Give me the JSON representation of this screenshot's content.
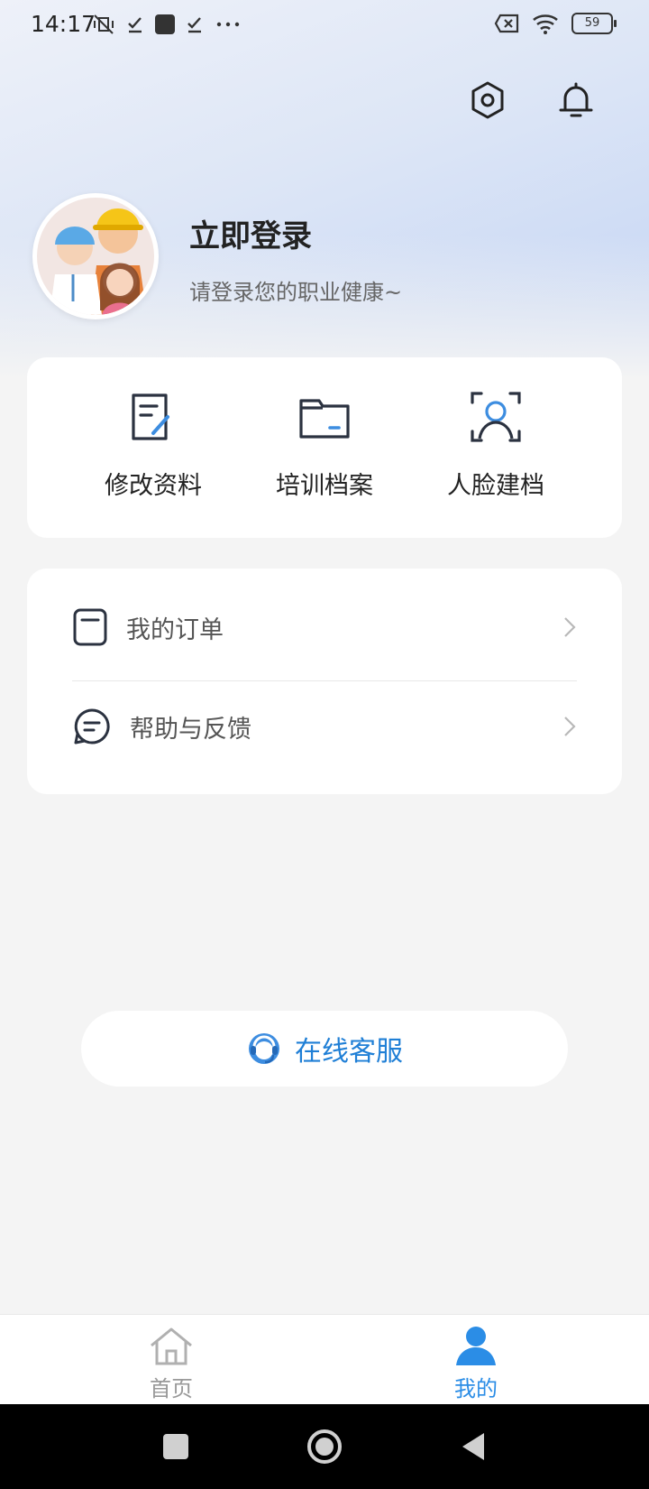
{
  "status_bar": {
    "time": "14:17",
    "battery": "59"
  },
  "profile": {
    "title": "立即登录",
    "subtitle": "请登录您的职业健康~"
  },
  "quick_actions": [
    {
      "label": "修改资料",
      "icon": "edit-document-icon"
    },
    {
      "label": "培训档案",
      "icon": "folder-icon"
    },
    {
      "label": "人脸建档",
      "icon": "face-scan-icon"
    }
  ],
  "menu": [
    {
      "label": "我的订单",
      "icon": "order-icon"
    },
    {
      "label": "帮助与反馈",
      "icon": "feedback-icon"
    }
  ],
  "service": {
    "label": "在线客服"
  },
  "tabs": [
    {
      "label": "首页",
      "active": false
    },
    {
      "label": "我的",
      "active": true
    }
  ],
  "colors": {
    "accent": "#1f7fd6",
    "active_tab": "#2b8de6",
    "inactive_tab": "#999999"
  }
}
